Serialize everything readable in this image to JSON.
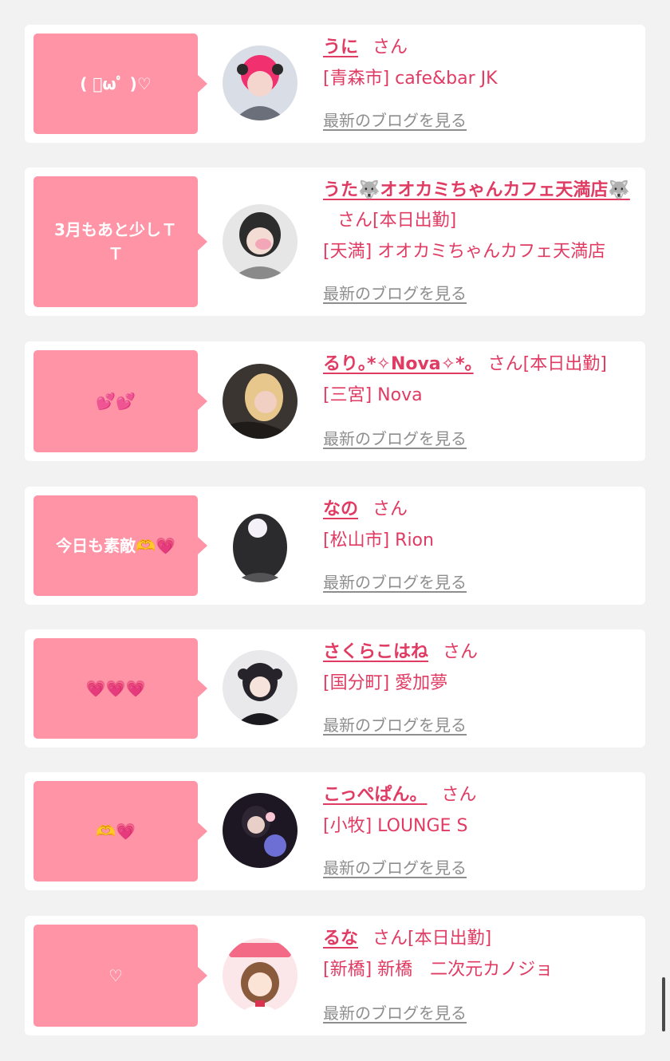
{
  "blog_link_label": "最新のブログを見る",
  "san_label": "さん",
  "colors": {
    "background": "#f2f2f3",
    "card": "#ffffff",
    "bubble": "#fe94a6",
    "accent": "#e03b63",
    "link_gray": "#8e8e8e"
  },
  "posts": [
    {
      "message": "( ﾟωﾟ )♡",
      "name": "うに",
      "badge": "",
      "shop": "[青森市] cafe&bar JK",
      "avatar": "girl-photo-icon"
    },
    {
      "message": "3月もあと少しＴ\nＴ",
      "name": "うた🐺オオカミちゃんカフェ天満店🐺",
      "badge": "[本日出勤]",
      "shop": "[天満] オオカミちゃんカフェ天満店",
      "avatar": "girl-photo-icon"
    },
    {
      "message": "💕💕",
      "name": "るり｡*✧Nova✧*｡",
      "badge": "[本日出勤]",
      "shop": "[三宮] Nova",
      "avatar": "girl-photo-icon"
    },
    {
      "message": "今日も素敵🫶💗",
      "name": "なの",
      "badge": "",
      "shop": "[松山市] Rion",
      "avatar": "girl-photo-icon"
    },
    {
      "message": "💗💗💗",
      "name": "さくらこはね",
      "badge": "",
      "shop": "[国分町] 愛加夢",
      "avatar": "girl-photo-icon"
    },
    {
      "message": "🫶💗",
      "name": "こっぺぱん。",
      "badge": "",
      "shop": "[小牧] LOUNGE S",
      "avatar": "girl-photo-icon"
    },
    {
      "message": "♡",
      "name": "るな",
      "badge": "[本日出勤]",
      "shop": "[新橋] 新橋　二次元カノジョ",
      "avatar": "anime-girl-illustration-icon"
    }
  ]
}
